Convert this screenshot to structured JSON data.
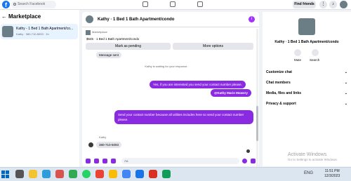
{
  "topbar": {
    "search_placeholder": "Search Facebook",
    "logo": "f",
    "find_friends": "Find friends"
  },
  "left": {
    "title": "Marketplace",
    "item_title": "Kathy - 1 Bed 1 Bath Apartment/co...",
    "item_sub": "Kathy · 380-710-5093 · 1h"
  },
  "chat": {
    "title": "Kathy · 1 Bed 1 Bath Apartment/condo",
    "info_icon": "i",
    "marketplace_label": "Marketplace",
    "listing": "$545 · 1 Bed 1 Bath Apartment/condo",
    "mark_pending": "Mark as pending",
    "more_options": "More options",
    "message_sent": "Message sent",
    "waiting": "Kathy is waiting for your response.",
    "out1": "Yes, if you are interested you send your contact number please.",
    "mention": "@Kathy Marie Mowery",
    "out2": "Send your contact number because all utilities includes here so send your contact number please.",
    "sender": "Kathy",
    "in_msg": "380-710-5093",
    "composer_placeholder": "Aa"
  },
  "right": {
    "name": "Kathy · 1 Bed 1 Bath Apartment/condo",
    "mute": "Mute",
    "search": "Search",
    "customize": "Customize chat",
    "members": "Chat members",
    "media": "Media, files and links",
    "privacy": "Privacy & support"
  },
  "watermark": {
    "title": "Activate Windows",
    "sub": "Go to Settings to activate Windows."
  },
  "taskbar": {
    "time": "11:51 PM",
    "date": "12/3/2023",
    "lang": "ENG"
  }
}
